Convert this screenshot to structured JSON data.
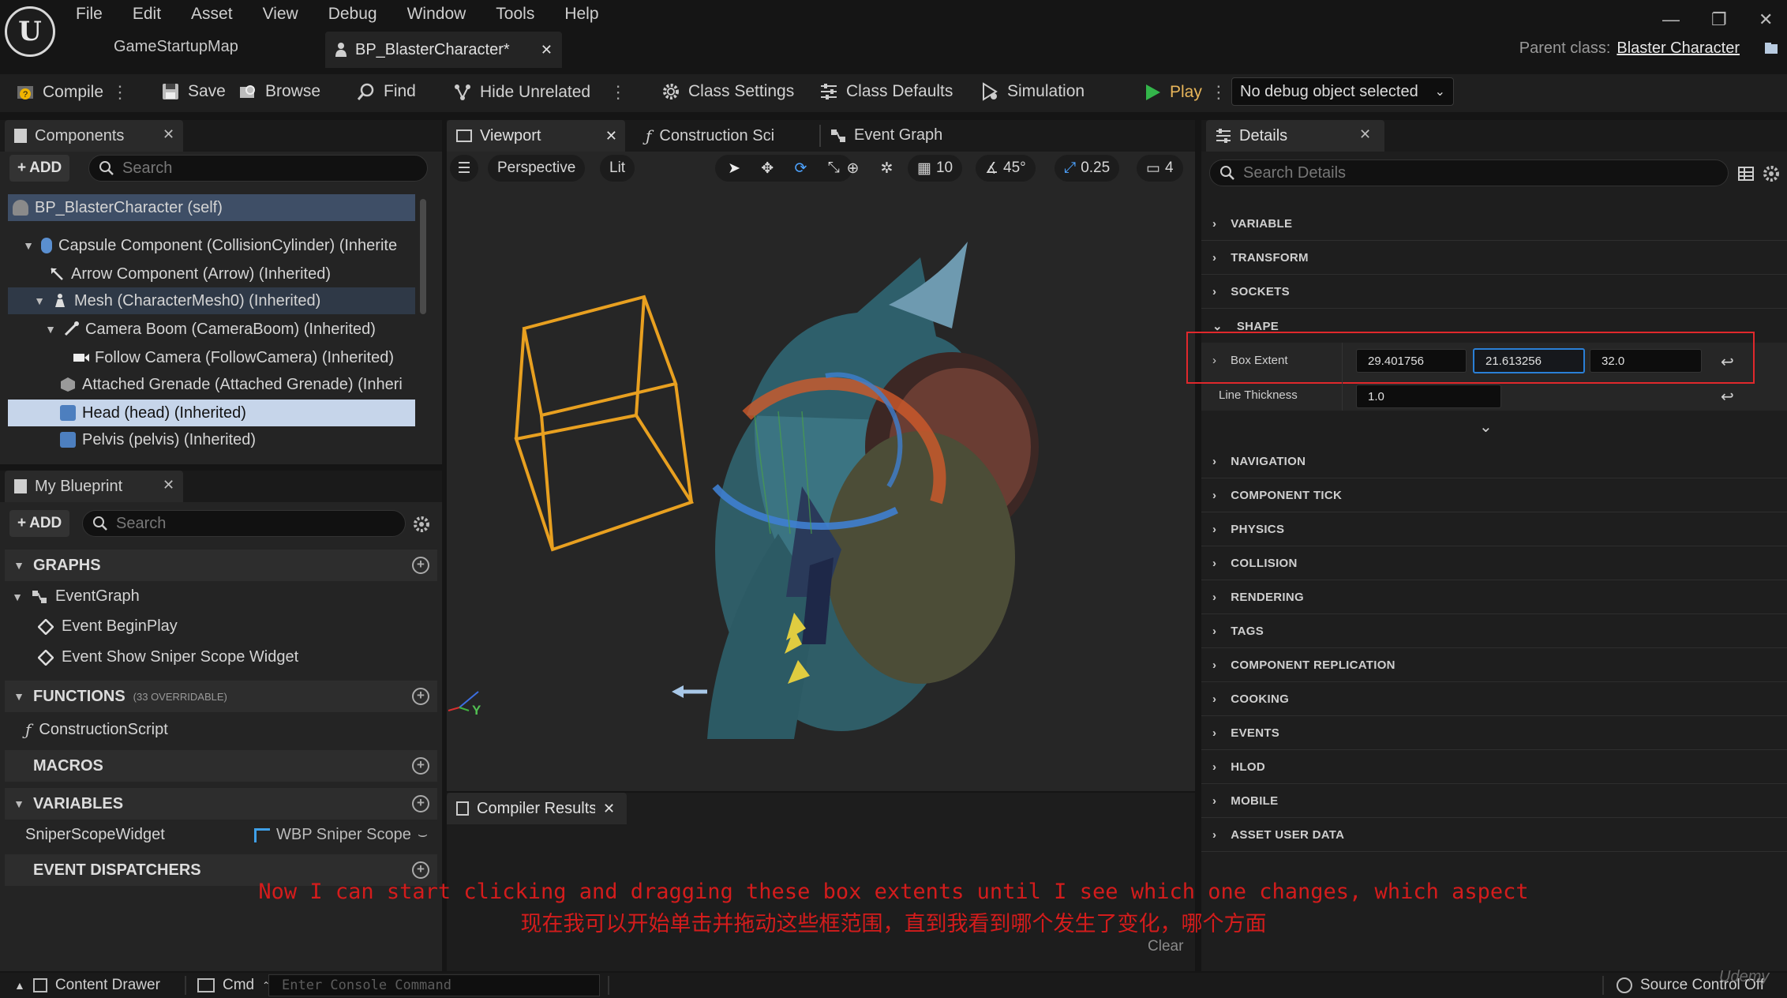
{
  "menu": [
    "File",
    "Edit",
    "Asset",
    "View",
    "Debug",
    "Window",
    "Tools",
    "Help"
  ],
  "tabs": {
    "map": "GameStartupMap",
    "blueprint": "BP_BlasterCharacter*"
  },
  "parent_class": {
    "label": "Parent class:",
    "value": "Blaster Character"
  },
  "toolbar": {
    "compile": "Compile",
    "save": "Save",
    "browse": "Browse",
    "find": "Find",
    "hide_unrelated": "Hide Unrelated",
    "class_settings": "Class Settings",
    "class_defaults": "Class Defaults",
    "simulation": "Simulation",
    "play": "Play",
    "debug_object": "No debug object selected"
  },
  "components": {
    "title": "Components",
    "add": "ADD",
    "search_placeholder": "Search",
    "items": [
      "BP_BlasterCharacter (self)",
      "Capsule Component (CollisionCylinder) (Inherite",
      "Arrow Component (Arrow) (Inherited)",
      "Mesh (CharacterMesh0) (Inherited)",
      "Camera Boom (CameraBoom) (Inherited)",
      "Follow Camera (FollowCamera) (Inherited)",
      "Attached Grenade (Attached Grenade) (Inheri",
      "Head (head) (Inherited)",
      "Pelvis (pelvis) (Inherited)"
    ]
  },
  "my_blueprint": {
    "title": "My Blueprint",
    "add": "ADD",
    "search_placeholder": "Search",
    "graphs": "GRAPHS",
    "event_graph": "EventGraph",
    "event_begin_play": "Event BeginPlay",
    "event_show_sniper": "Event Show Sniper Scope Widget",
    "functions": "FUNCTIONS",
    "functions_note": "(33 OVERRIDABLE)",
    "construction_script": "ConstructionScript",
    "macros": "MACROS",
    "variables": "VARIABLES",
    "var_name": "SniperScopeWidget",
    "var_type": "WBP Sniper Scope",
    "event_dispatchers": "EVENT DISPATCHERS"
  },
  "center_tabs": {
    "viewport": "Viewport",
    "construction": "Construction Sci",
    "event_graph": "Event Graph"
  },
  "viewport": {
    "perspective": "Perspective",
    "lit": "Lit",
    "grid_snap": "10",
    "angle_snap": "45°",
    "scale_snap": "0.25",
    "camera_speed": "4",
    "axis_y": "Y"
  },
  "compiler": {
    "title": "Compiler Results",
    "clear": "Clear"
  },
  "details": {
    "title": "Details",
    "search_placeholder": "Search Details",
    "categories_top": [
      "VARIABLE",
      "TRANSFORM",
      "SOCKETS",
      "SHAPE"
    ],
    "box_extent_label": "Box Extent",
    "box_extent": [
      "29.401756",
      "21.613256",
      "32.0"
    ],
    "line_thickness_label": "Line Thickness",
    "line_thickness": "1.0",
    "categories_bottom": [
      "NAVIGATION",
      "COMPONENT TICK",
      "PHYSICS",
      "COLLISION",
      "RENDERING",
      "TAGS",
      "COMPONENT REPLICATION",
      "COOKING",
      "EVENTS",
      "HLOD",
      "MOBILE",
      "ASSET USER DATA"
    ]
  },
  "subtitles": {
    "en": "Now I can start clicking and dragging these box extents until I see which one changes, which aspect",
    "zh": "现在我可以开始单击并拖动这些框范围，直到我看到哪个发生了变化，哪个方面"
  },
  "bottom": {
    "content_drawer": "Content Drawer",
    "cmd": "Cmd",
    "console_placeholder": "Enter Console Command",
    "source_control": "Source Control Off",
    "watermark": "Udemy"
  },
  "colors": {
    "accent_blue": "#2a7fd6",
    "highlight_red": "#e0282c",
    "selection": "#c6d5ea",
    "play_green": "#33b54a"
  }
}
